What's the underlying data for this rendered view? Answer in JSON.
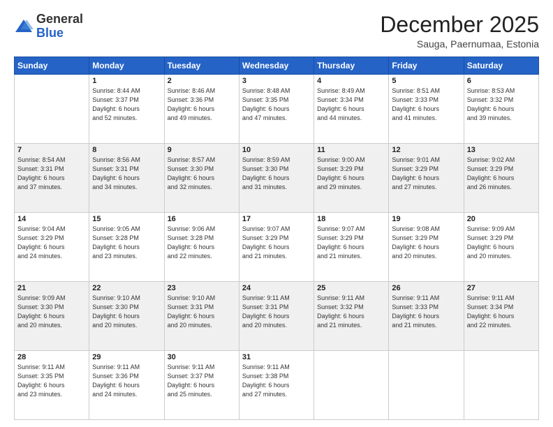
{
  "logo": {
    "general": "General",
    "blue": "Blue"
  },
  "header": {
    "month": "December 2025",
    "location": "Sauga, Paernumaa, Estonia"
  },
  "days_of_week": [
    "Sunday",
    "Monday",
    "Tuesday",
    "Wednesday",
    "Thursday",
    "Friday",
    "Saturday"
  ],
  "weeks": [
    [
      {
        "day": "",
        "info": ""
      },
      {
        "day": "1",
        "info": "Sunrise: 8:44 AM\nSunset: 3:37 PM\nDaylight: 6 hours\nand 52 minutes."
      },
      {
        "day": "2",
        "info": "Sunrise: 8:46 AM\nSunset: 3:36 PM\nDaylight: 6 hours\nand 49 minutes."
      },
      {
        "day": "3",
        "info": "Sunrise: 8:48 AM\nSunset: 3:35 PM\nDaylight: 6 hours\nand 47 minutes."
      },
      {
        "day": "4",
        "info": "Sunrise: 8:49 AM\nSunset: 3:34 PM\nDaylight: 6 hours\nand 44 minutes."
      },
      {
        "day": "5",
        "info": "Sunrise: 8:51 AM\nSunset: 3:33 PM\nDaylight: 6 hours\nand 41 minutes."
      },
      {
        "day": "6",
        "info": "Sunrise: 8:53 AM\nSunset: 3:32 PM\nDaylight: 6 hours\nand 39 minutes."
      }
    ],
    [
      {
        "day": "7",
        "info": "Sunrise: 8:54 AM\nSunset: 3:31 PM\nDaylight: 6 hours\nand 37 minutes."
      },
      {
        "day": "8",
        "info": "Sunrise: 8:56 AM\nSunset: 3:31 PM\nDaylight: 6 hours\nand 34 minutes."
      },
      {
        "day": "9",
        "info": "Sunrise: 8:57 AM\nSunset: 3:30 PM\nDaylight: 6 hours\nand 32 minutes."
      },
      {
        "day": "10",
        "info": "Sunrise: 8:59 AM\nSunset: 3:30 PM\nDaylight: 6 hours\nand 31 minutes."
      },
      {
        "day": "11",
        "info": "Sunrise: 9:00 AM\nSunset: 3:29 PM\nDaylight: 6 hours\nand 29 minutes."
      },
      {
        "day": "12",
        "info": "Sunrise: 9:01 AM\nSunset: 3:29 PM\nDaylight: 6 hours\nand 27 minutes."
      },
      {
        "day": "13",
        "info": "Sunrise: 9:02 AM\nSunset: 3:29 PM\nDaylight: 6 hours\nand 26 minutes."
      }
    ],
    [
      {
        "day": "14",
        "info": "Sunrise: 9:04 AM\nSunset: 3:29 PM\nDaylight: 6 hours\nand 24 minutes."
      },
      {
        "day": "15",
        "info": "Sunrise: 9:05 AM\nSunset: 3:28 PM\nDaylight: 6 hours\nand 23 minutes."
      },
      {
        "day": "16",
        "info": "Sunrise: 9:06 AM\nSunset: 3:28 PM\nDaylight: 6 hours\nand 22 minutes."
      },
      {
        "day": "17",
        "info": "Sunrise: 9:07 AM\nSunset: 3:29 PM\nDaylight: 6 hours\nand 21 minutes."
      },
      {
        "day": "18",
        "info": "Sunrise: 9:07 AM\nSunset: 3:29 PM\nDaylight: 6 hours\nand 21 minutes."
      },
      {
        "day": "19",
        "info": "Sunrise: 9:08 AM\nSunset: 3:29 PM\nDaylight: 6 hours\nand 20 minutes."
      },
      {
        "day": "20",
        "info": "Sunrise: 9:09 AM\nSunset: 3:29 PM\nDaylight: 6 hours\nand 20 minutes."
      }
    ],
    [
      {
        "day": "21",
        "info": "Sunrise: 9:09 AM\nSunset: 3:30 PM\nDaylight: 6 hours\nand 20 minutes."
      },
      {
        "day": "22",
        "info": "Sunrise: 9:10 AM\nSunset: 3:30 PM\nDaylight: 6 hours\nand 20 minutes."
      },
      {
        "day": "23",
        "info": "Sunrise: 9:10 AM\nSunset: 3:31 PM\nDaylight: 6 hours\nand 20 minutes."
      },
      {
        "day": "24",
        "info": "Sunrise: 9:11 AM\nSunset: 3:31 PM\nDaylight: 6 hours\nand 20 minutes."
      },
      {
        "day": "25",
        "info": "Sunrise: 9:11 AM\nSunset: 3:32 PM\nDaylight: 6 hours\nand 21 minutes."
      },
      {
        "day": "26",
        "info": "Sunrise: 9:11 AM\nSunset: 3:33 PM\nDaylight: 6 hours\nand 21 minutes."
      },
      {
        "day": "27",
        "info": "Sunrise: 9:11 AM\nSunset: 3:34 PM\nDaylight: 6 hours\nand 22 minutes."
      }
    ],
    [
      {
        "day": "28",
        "info": "Sunrise: 9:11 AM\nSunset: 3:35 PM\nDaylight: 6 hours\nand 23 minutes."
      },
      {
        "day": "29",
        "info": "Sunrise: 9:11 AM\nSunset: 3:36 PM\nDaylight: 6 hours\nand 24 minutes."
      },
      {
        "day": "30",
        "info": "Sunrise: 9:11 AM\nSunset: 3:37 PM\nDaylight: 6 hours\nand 25 minutes."
      },
      {
        "day": "31",
        "info": "Sunrise: 9:11 AM\nSunset: 3:38 PM\nDaylight: 6 hours\nand 27 minutes."
      },
      {
        "day": "",
        "info": ""
      },
      {
        "day": "",
        "info": ""
      },
      {
        "day": "",
        "info": ""
      }
    ]
  ]
}
